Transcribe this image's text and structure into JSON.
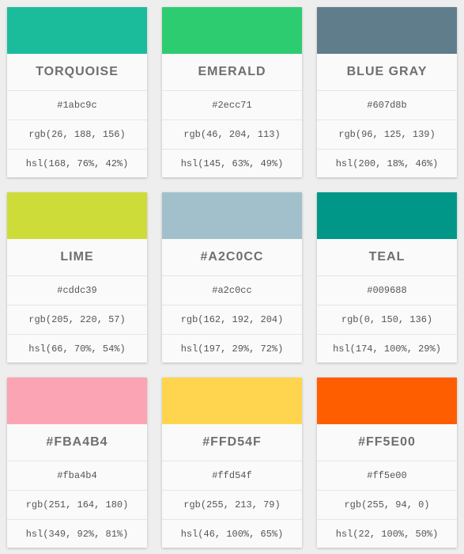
{
  "cards": [
    {
      "name": "TORQUOISE",
      "hex": "#1abc9c",
      "rgb": "rgb(26, 188, 156)",
      "hsl": "hsl(168, 76%, 42%)",
      "color": "#1abc9c"
    },
    {
      "name": "EMERALD",
      "hex": "#2ecc71",
      "rgb": "rgb(46, 204, 113)",
      "hsl": "hsl(145, 63%, 49%)",
      "color": "#2ecc71"
    },
    {
      "name": "BLUE GRAY",
      "hex": "#607d8b",
      "rgb": "rgb(96, 125, 139)",
      "hsl": "hsl(200, 18%, 46%)",
      "color": "#607d8b"
    },
    {
      "name": "LIME",
      "hex": "#cddc39",
      "rgb": "rgb(205, 220, 57)",
      "hsl": "hsl(66, 70%, 54%)",
      "color": "#cddc39"
    },
    {
      "name": "#A2C0CC",
      "hex": "#a2c0cc",
      "rgb": "rgb(162, 192, 204)",
      "hsl": "hsl(197, 29%, 72%)",
      "color": "#a2c0cc"
    },
    {
      "name": "TEAL",
      "hex": "#009688",
      "rgb": "rgb(0, 150, 136)",
      "hsl": "hsl(174, 100%, 29%)",
      "color": "#009688"
    },
    {
      "name": "#FBA4B4",
      "hex": "#fba4b4",
      "rgb": "rgb(251, 164, 180)",
      "hsl": "hsl(349, 92%, 81%)",
      "color": "#fba4b4"
    },
    {
      "name": "#FFD54F",
      "hex": "#ffd54f",
      "rgb": "rgb(255, 213, 79)",
      "hsl": "hsl(46, 100%, 65%)",
      "color": "#ffd54f"
    },
    {
      "name": "#FF5E00",
      "hex": "#ff5e00",
      "rgb": "rgb(255, 94, 0)",
      "hsl": "hsl(22, 100%, 50%)",
      "color": "#ff5e00"
    }
  ]
}
